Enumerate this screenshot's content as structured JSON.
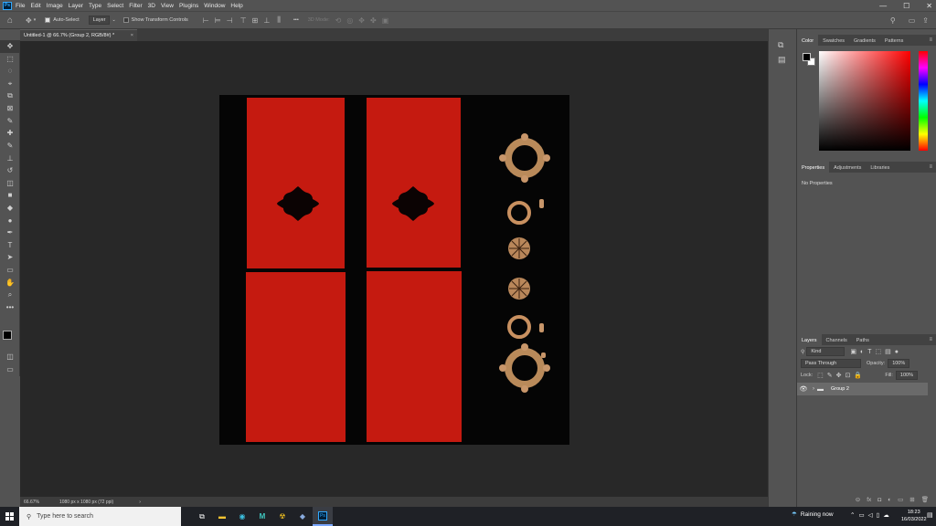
{
  "app": {
    "logo": "Ps"
  },
  "menu": [
    "File",
    "Edit",
    "Image",
    "Layer",
    "Type",
    "Select",
    "Filter",
    "3D",
    "View",
    "Plugins",
    "Window",
    "Help"
  ],
  "window_controls": {
    "minimize": "—",
    "maximize": "☐",
    "close": "✕"
  },
  "options_bar": {
    "auto_select_label": "Auto-Select",
    "auto_select_checked": true,
    "auto_select_target": "Layer",
    "show_transform_label": "Show Transform Controls",
    "show_transform_checked": false,
    "more": "•••",
    "mode_3d_label": "3D Mode:"
  },
  "document": {
    "tab_title": "Untitled-1 @ 66.7% (Group 2, RGB/8#) *",
    "tab_close": "×",
    "zoom": "66.67%",
    "size_info": "1080 px x 1080 px (72 ppi)",
    "status_arrow": "›"
  },
  "tools": [
    "move-tool",
    "marquee-tool",
    "lasso-tool",
    "object-select-tool",
    "crop-tool",
    "frame-tool",
    "eyedropper-tool",
    "healing-brush-tool",
    "brush-tool",
    "clone-stamp-tool",
    "history-brush-tool",
    "eraser-tool",
    "gradient-tool",
    "blur-tool",
    "dodge-tool",
    "pen-tool",
    "type-tool",
    "path-selection-tool",
    "rectangle-tool",
    "hand-tool",
    "zoom-tool",
    "more-tools"
  ],
  "tool_glyphs": [
    "✥",
    "⬚",
    "◌",
    "⌖",
    "⧉",
    "⊠",
    "✎",
    "✚",
    "✎",
    "⊥",
    "↺",
    "◫",
    "■",
    "◆",
    "●",
    "✒",
    "T",
    "➤",
    "▭",
    "✋",
    "⌕",
    "•••"
  ],
  "color_panel": {
    "tabs": [
      "Color",
      "Swatches",
      "Gradients",
      "Patterns"
    ],
    "active_tab": "Color",
    "foreground": "#000000",
    "background": "#ffffff",
    "hue_color": "#ff0000"
  },
  "properties_panel": {
    "tabs": [
      "Properties",
      "Adjustments",
      "Libraries"
    ],
    "active_tab": "Properties",
    "empty_text": "No Properties"
  },
  "layers_panel": {
    "tabs": [
      "Layers",
      "Channels",
      "Paths"
    ],
    "active_tab": "Layers",
    "filter_kind": "Kind",
    "blend_mode": "Pass Through",
    "opacity_label": "Opacity:",
    "opacity_value": "100%",
    "lock_label": "Lock:",
    "fill_label": "Fill:",
    "fill_value": "100%",
    "layers": [
      {
        "name": "Group 2",
        "visible": true,
        "type": "group"
      }
    ],
    "footer_icons": [
      "link-icon",
      "fx-icon",
      "mask-icon",
      "adjustment-icon",
      "folder-icon",
      "new-layer-icon",
      "trash-icon"
    ],
    "footer_glyphs": [
      "⊝",
      "fx",
      "◘",
      "◐",
      "▭",
      "⊞",
      "🗑"
    ]
  },
  "taskbar": {
    "search_placeholder": "Type here to search",
    "weather": "Raining now",
    "time": "18:23",
    "date": "16/03/2022"
  }
}
